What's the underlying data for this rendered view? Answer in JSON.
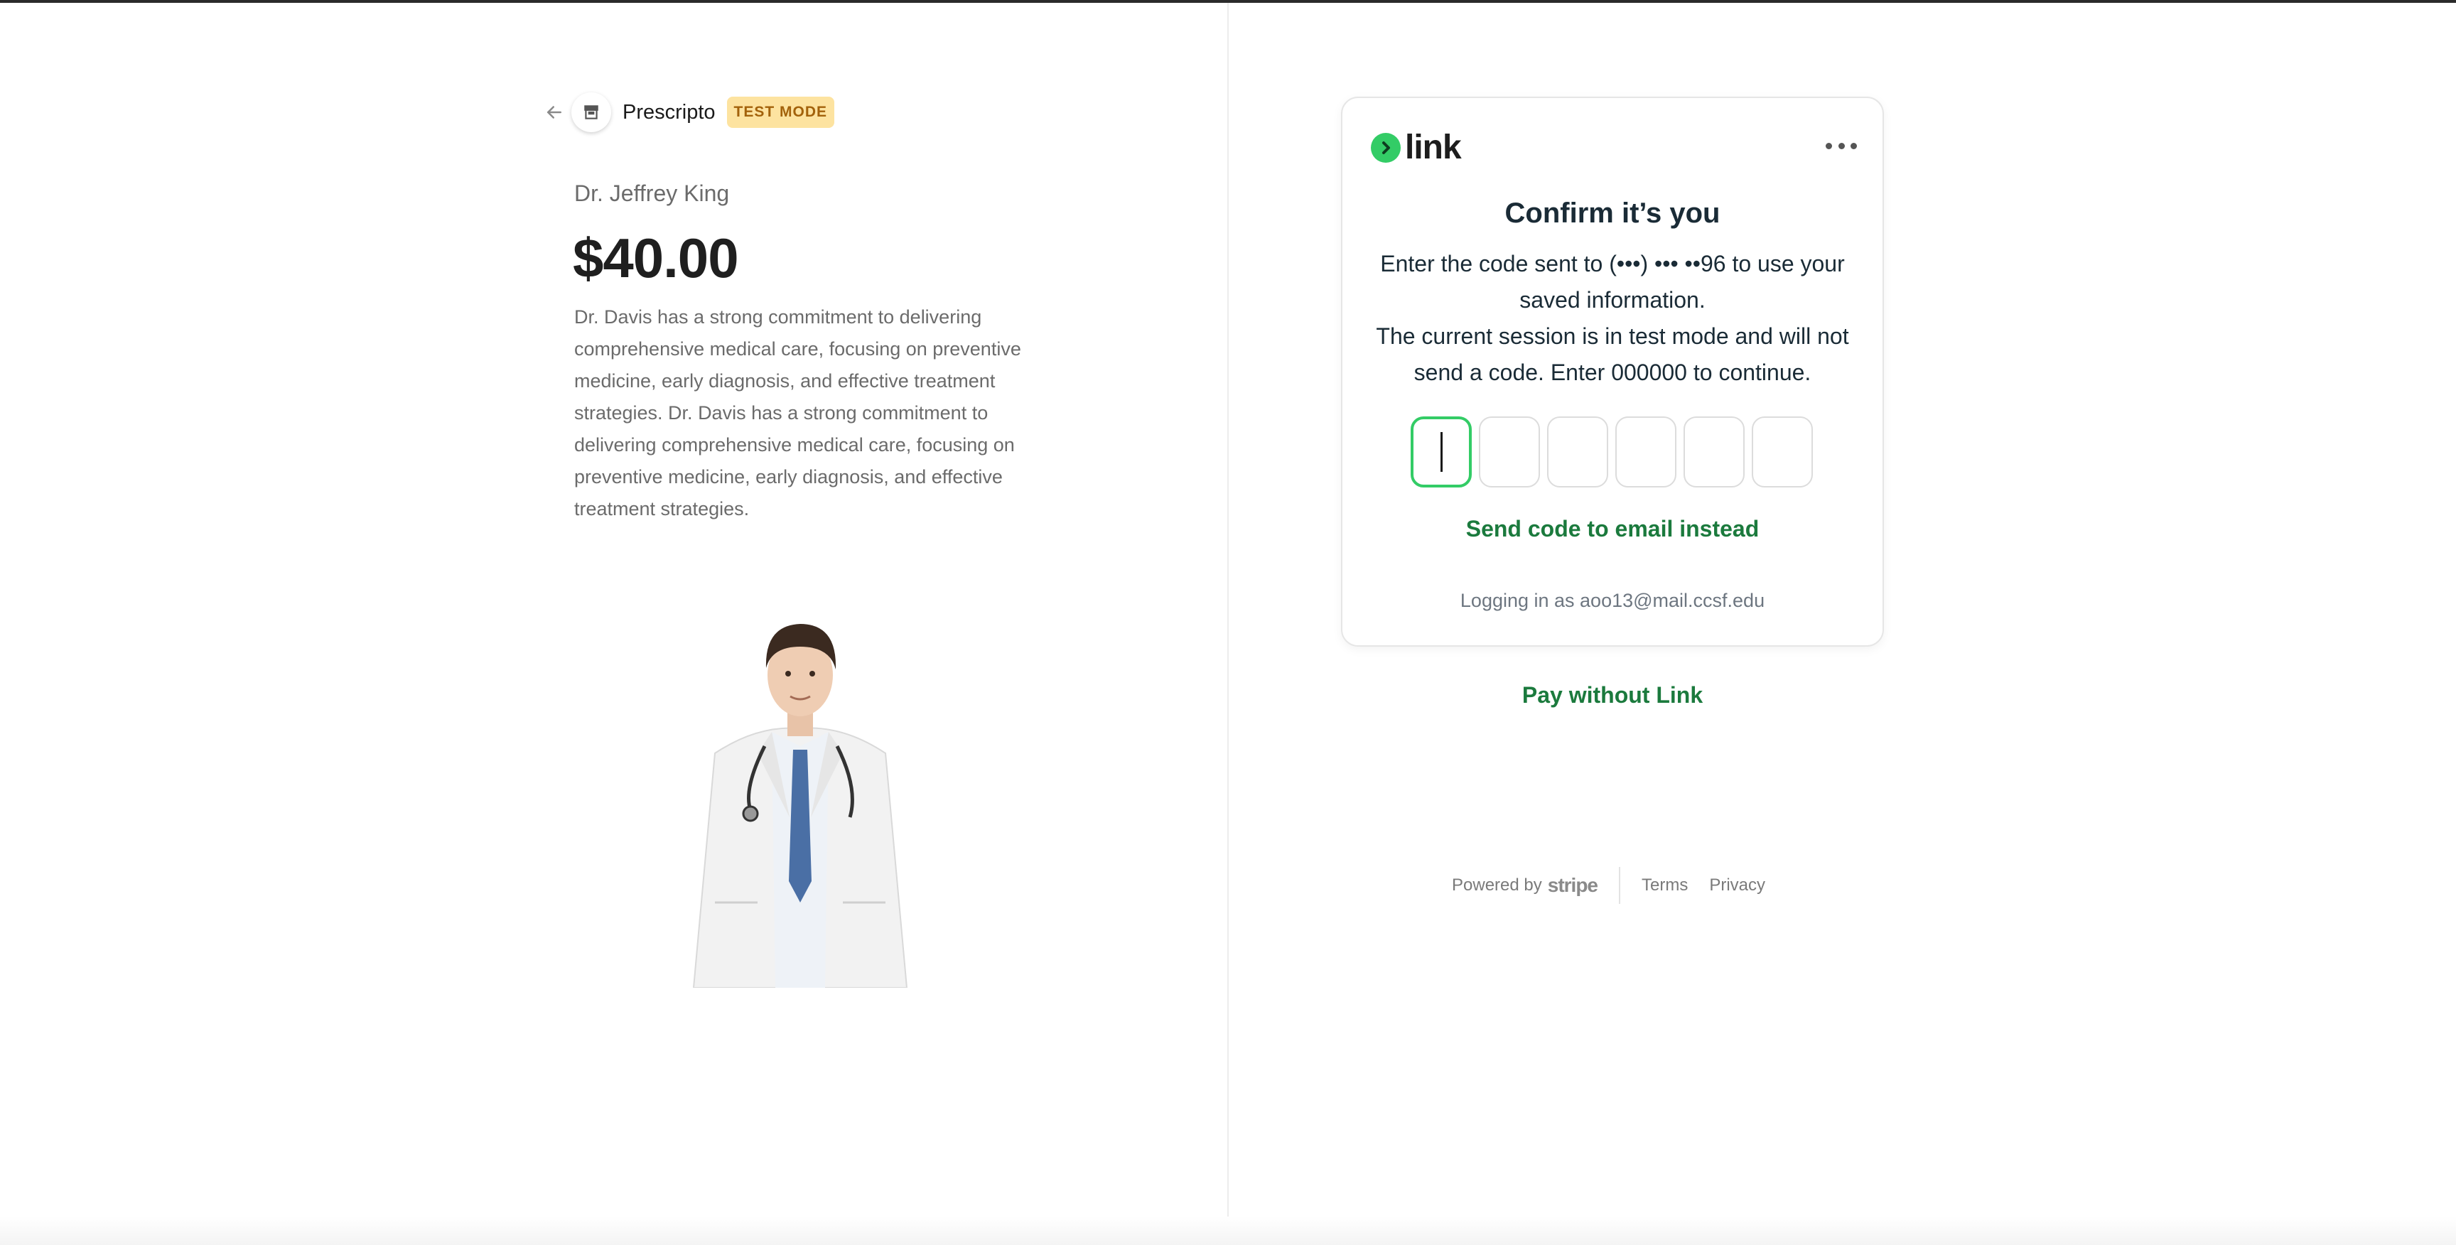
{
  "merchant": {
    "name": "Prescripto",
    "test_badge": "TEST MODE"
  },
  "product": {
    "name": "Dr. Jeffrey King",
    "price": "$40.00",
    "description": "Dr. Davis has a strong commitment to delivering comprehensive medical care, focusing on preventive medicine, early diagnosis, and effective treatment strategies. Dr. Davis has a strong commitment to delivering comprehensive medical care, focusing on preventive medicine, early diagnosis, and effective treatment strategies."
  },
  "link_card": {
    "brand": "link",
    "title": "Confirm it’s you",
    "message_line1": "Enter the code sent to (•••) ••• ••96 to use your saved information.",
    "message_line2": "The current session is in test mode and will not send a code. Enter 000000 to continue.",
    "code_digits": [
      "",
      "",
      "",
      "",
      "",
      ""
    ],
    "email_instead": "Send code to email instead",
    "logging_in": "Logging in as aoo13@mail.ccsf.edu"
  },
  "pay_without_link": "Pay without Link",
  "footer": {
    "powered_by": "Powered by",
    "stripe": "stripe",
    "terms": "Terms",
    "privacy": "Privacy"
  },
  "colors": {
    "accent_green": "#33cc66",
    "link_text_green": "#1b7a3d",
    "badge_bg": "#fde3a0",
    "badge_text": "#a3620b"
  },
  "icons": {
    "back": "arrow-left-icon",
    "store": "store-icon",
    "link_mark": "chevron-right-icon",
    "more": "more-horizontal-icon"
  }
}
